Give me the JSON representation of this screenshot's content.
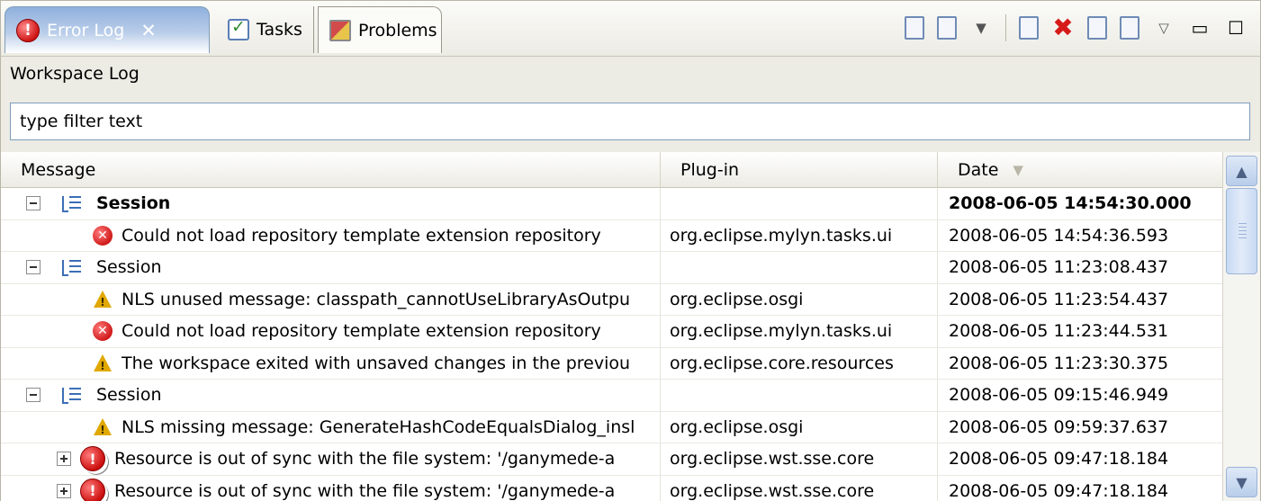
{
  "tabs": [
    {
      "label": "Error Log",
      "active": true,
      "icon": "error-log-icon"
    },
    {
      "label": "Tasks",
      "active": false,
      "icon": "tasks-icon"
    },
    {
      "label": "Problems",
      "active": false,
      "icon": "problems-icon"
    }
  ],
  "toolbar": {
    "icons": [
      "export-log-icon",
      "import-log-icon",
      "dropdown-arrow-icon",
      "clear-log-icon",
      "delete-log-icon",
      "open-log-icon",
      "restore-log-icon",
      "view-menu-icon",
      "minimize-icon",
      "maximize-icon"
    ]
  },
  "header": {
    "title": "Workspace Log"
  },
  "filter": {
    "value": "type filter text"
  },
  "columns": {
    "message": "Message",
    "plugin": "Plug-in",
    "date": "Date"
  },
  "rows": [
    {
      "type": "session",
      "expander": "minus",
      "message": "Session",
      "plugin": "",
      "date": "2008-06-05 14:54:30.000",
      "bold": true
    },
    {
      "type": "error",
      "message": "Could not load repository template extension repository",
      "plugin": "org.eclipse.mylyn.tasks.ui",
      "date": "2008-06-05 14:54:36.593"
    },
    {
      "type": "session",
      "expander": "minus",
      "message": "Session",
      "plugin": "",
      "date": "2008-06-05 11:23:08.437"
    },
    {
      "type": "warning",
      "message": "NLS unused message: classpath_cannotUseLibraryAsOutpu",
      "plugin": "org.eclipse.osgi",
      "date": "2008-06-05 11:23:54.437"
    },
    {
      "type": "error",
      "message": "Could not load repository template extension repository",
      "plugin": "org.eclipse.mylyn.tasks.ui",
      "date": "2008-06-05 11:23:44.531"
    },
    {
      "type": "warning",
      "message": "The workspace exited with unsaved changes in the previou",
      "plugin": "org.eclipse.core.resources",
      "date": "2008-06-05 11:23:30.375"
    },
    {
      "type": "session",
      "expander": "minus",
      "message": "Session",
      "plugin": "",
      "date": "2008-06-05 09:15:46.949"
    },
    {
      "type": "warning",
      "message": "NLS missing message: GenerateHashCodeEqualsDialog_insl",
      "plugin": "org.eclipse.osgi",
      "date": "2008-06-05 09:59:37.637"
    },
    {
      "type": "error-nested",
      "expander": "plus",
      "message": "Resource is out of sync with the file system: '/ganymede-a",
      "plugin": "org.eclipse.wst.sse.core",
      "date": "2008-06-05 09:47:18.184"
    },
    {
      "type": "error-nested",
      "expander": "plus",
      "message": "Resource is out of sync with the file system: '/ganymede-a",
      "plugin": "org.eclipse.wst.sse.core",
      "date": "2008-06-05 09:47:18.184"
    }
  ]
}
